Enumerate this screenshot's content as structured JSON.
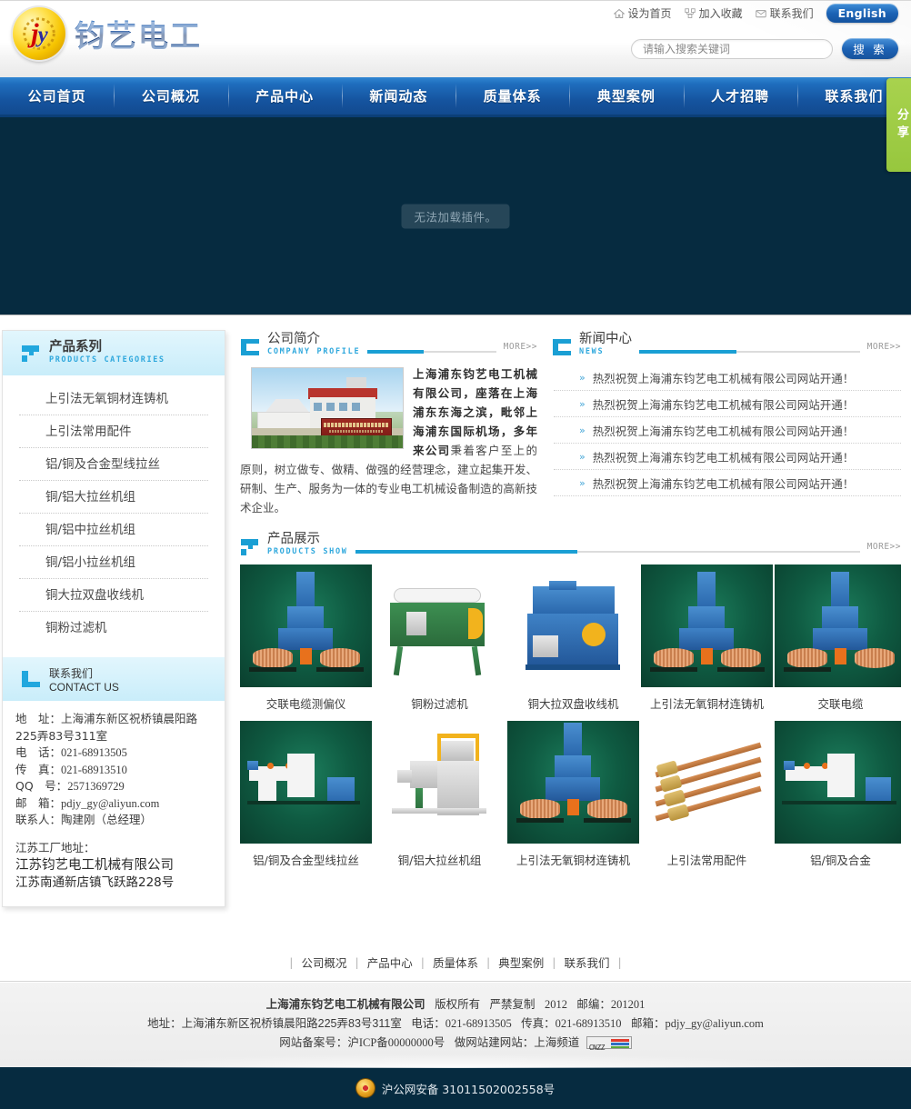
{
  "header": {
    "logo_text": "钧艺电工",
    "logo_initials_j": "j",
    "logo_initials_y": "y",
    "util": [
      {
        "label": "设为首页",
        "icon": "home-icon"
      },
      {
        "label": "加入收藏",
        "icon": "star-favorite-icon"
      },
      {
        "label": "联系我们",
        "icon": "mail-icon"
      }
    ],
    "english_button": "English",
    "search": {
      "placeholder": "请输入搜索关键词",
      "value": "",
      "button_label": "搜 索"
    }
  },
  "nav": {
    "items": [
      "公司首页",
      "公司概况",
      "产品中心",
      "新闻动态",
      "质量体系",
      "典型案例",
      "人才招聘",
      "联系我们"
    ]
  },
  "banner": {
    "plugin_message": "无法加载插件。",
    "share_label": "分享"
  },
  "sidebar": {
    "categories_head": {
      "zh": "产品系列",
      "en": "PRODUCTS CATEGORIES"
    },
    "categories": [
      "上引法无氧铜材连铸机",
      "上引法常用配件",
      "铝/铜及合金型线拉丝",
      "铜/铝大拉丝机组",
      "铜/铝中拉丝机组",
      "铜/铝小拉丝机组",
      "铜大拉双盘收线机",
      "铜粉过滤机"
    ],
    "contact_head": {
      "zh": "联系我们",
      "en": "CONTACT US"
    },
    "contact": {
      "address_label": "地　址：",
      "address_value": "上海浦东新区祝桥镇晨阳路225弄83号311室",
      "tel_label": "电　话：",
      "tel_value": "021-68913505",
      "fax_label": "传　真：",
      "fax_value": "021-68913510",
      "qq_label": "QQ　号：",
      "qq_value": "2571369729",
      "email_label": "邮　箱：",
      "email_value": "pdjy_gy@aliyun.com",
      "person_label": "联系人：",
      "person_value": "陶建刚（总经理）",
      "factory_label": "江苏工厂地址：",
      "factory_name": "江苏钧艺电工机械有限公司",
      "factory_address": "江苏南通新店镇飞跃路228号"
    }
  },
  "profile": {
    "head": {
      "zh": "公司简介",
      "en": "COMPANY PROFILE"
    },
    "more": "MORE>>",
    "lead": "上海浦东钧艺电工机械有限公司，座落在上海浦东东海之滨，毗邻上海浦东国际机场，多年来公司",
    "body": "秉着客户至上的原则，树立做专、做精、做强的经营理念，建立起集开发、研制、生产、服务为一体的专业电工机械设备制造的高新技术企业。"
  },
  "news": {
    "head": {
      "zh": "新闻中心",
      "en": "NEWS"
    },
    "more": "MORE>>",
    "items": [
      "热烈祝贺上海浦东钧艺电工机械有限公司网站开通！",
      "热烈祝贺上海浦东钧艺电工机械有限公司网站开通！",
      "热烈祝贺上海浦东钧艺电工机械有限公司网站开通！",
      "热烈祝贺上海浦东钧艺电工机械有限公司网站开通！",
      "热烈祝贺上海浦东钧艺电工机械有限公司网站开通！"
    ]
  },
  "products": {
    "head": {
      "zh": "产品展示",
      "en": "PRODUCTS SHOW"
    },
    "more": "MORE>>",
    "row1": [
      {
        "caption": "交联电缆测偏仪",
        "style": "casting"
      },
      {
        "caption": "铜粉过滤机",
        "style": "filter"
      },
      {
        "caption": "铜大拉双盘收线机",
        "style": "bluemachine"
      },
      {
        "caption": "上引法无氧铜材连铸机",
        "style": "casting"
      },
      {
        "caption": "交联电缆",
        "style": "casting"
      }
    ],
    "row2": [
      {
        "caption": "铝/铜及合金型线拉丝",
        "style": "drawline"
      },
      {
        "caption": "铜/铝大拉丝机组",
        "style": "greyline"
      },
      {
        "caption": "上引法无氧铜材连铸机",
        "style": "casting"
      },
      {
        "caption": "上引法常用配件",
        "style": "brass"
      },
      {
        "caption": "铝/铜及合金",
        "style": "drawline"
      }
    ]
  },
  "footer": {
    "nav": [
      "公司概况",
      "产品中心",
      "质量体系",
      "典型案例",
      "联系我们"
    ],
    "company": "上海浦东钧艺电工机械有限公司",
    "copyright": "版权所有",
    "forbid": "严禁复制",
    "year": "2012",
    "zip_label": "邮编：",
    "zip_value": "201201",
    "address_label": "地址：",
    "address_value": "上海浦东新区祝桥镇晨阳路225弄83号311室",
    "tel_label": "电话：",
    "tel_value": "021-68913505",
    "fax_label": "传真：",
    "fax_value": "021-68913510",
    "email_label": "邮箱：",
    "email_value": "pdjy_gy@aliyun.com",
    "icp_label": "网站备案号：",
    "icp_value": "沪ICP备00000000号",
    "build_label": "做网站建网站：",
    "build_value": "上海频道",
    "cnzz_label": "CNZZ",
    "beian": "沪公网安备 31011502002558号"
  },
  "colors": {
    "nav_blue": "#15549f",
    "accent_cyan": "#1a9fd4",
    "banner_navy": "#062b40",
    "share_green": "#a8d24e"
  }
}
